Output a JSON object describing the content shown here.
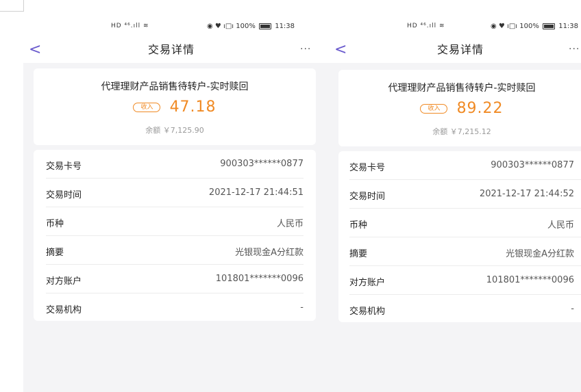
{
  "screens": [
    {
      "status": {
        "network": "HD ⁴⁶.ıll ≋",
        "right": "◉ ♥ ı□ı 100%",
        "time": "11:38"
      },
      "nav": {
        "back": "<",
        "title": "交易详情",
        "more": "···"
      },
      "summary": {
        "title": "代理理财产品销售待转户-实时赎回",
        "badge": "收入",
        "amount": "47.18",
        "balance": "余额 ￥7,125.90"
      },
      "details": [
        {
          "label": "交易卡号",
          "value": "900303******0877"
        },
        {
          "label": "交易时间",
          "value": "2021-12-17 21:44:51"
        },
        {
          "label": "币种",
          "value": "人民币"
        },
        {
          "label": "摘要",
          "value": "光银现金A分红款"
        },
        {
          "label": "对方账户",
          "value": "101801*******0096"
        },
        {
          "label": "交易机构",
          "value": "-"
        }
      ]
    },
    {
      "status": {
        "network": "HD ⁴⁶.ıll ≋",
        "right": "◉ ♥ ı□ı 100%",
        "time": "11:38"
      },
      "nav": {
        "back": "<",
        "title": "交易详情",
        "more": "···"
      },
      "summary": {
        "title": "代理理财产品销售待转户-实时赎回",
        "badge": "收入",
        "amount": "89.22",
        "balance": "余额 ￥7,215.12"
      },
      "details": [
        {
          "label": "交易卡号",
          "value": "900303******0877"
        },
        {
          "label": "交易时间",
          "value": "2021-12-17 21:44:52"
        },
        {
          "label": "币种",
          "value": "人民币"
        },
        {
          "label": "摘要",
          "value": "光银现金A分红款"
        },
        {
          "label": "对方账户",
          "value": "101801*******0096"
        },
        {
          "label": "交易机构",
          "value": "-"
        }
      ]
    }
  ],
  "colors": {
    "accent": "#f08a24",
    "back": "#6a5acd",
    "background": "#f4f4f6"
  }
}
